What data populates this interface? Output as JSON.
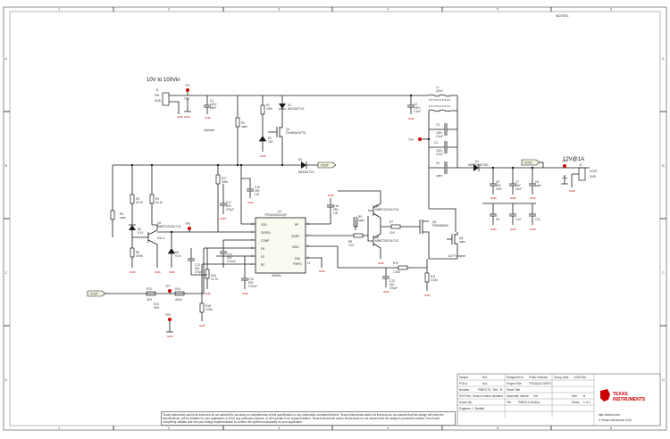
{
  "grid": {
    "cols": [
      "1",
      "2",
      "3",
      "4",
      "5",
      "6"
    ],
    "rows": [
      "A",
      "B",
      "C",
      "D"
    ]
  },
  "notes_label": "NOTES:",
  "input": {
    "range": "10V to 100Vin",
    "connector": "J1",
    "pin_vin": "VIN",
    "pin_gnd": "GND"
  },
  "output": {
    "rating": "12V@1A",
    "connector": "J2",
    "pin_vout": "VOUT",
    "pin_gnd": "GND"
  },
  "ic": {
    "ref": "U1",
    "part": "TPS40210DGQR",
    "freq": "300kHz",
    "pins_left": [
      "VDD",
      "DIS/EN",
      "COMP",
      "FB",
      "SS",
      "RC"
    ],
    "pins_right": [
      "BP",
      "GDRV",
      "ISNS",
      "PAD",
      "PWPD"
    ],
    "pin_nums_left": [
      "10",
      "2",
      "4",
      "5",
      "3",
      "1"
    ],
    "pin_nums_right": [
      "8",
      "7",
      "6",
      "9",
      "11"
    ]
  },
  "components": {
    "d1": "D1",
    "d1p": "BAS16HT1G",
    "q1": "Q1",
    "q1p": "ZXMN3A01FTA",
    "d2": "D2",
    "d2v": "15V",
    "r1": "R1",
    "r1v": "100k",
    "c1": "C1",
    "c1a": "100V",
    "c1b": "68uF",
    "c1c": "Optional",
    "r2": "R2",
    "r2v": "open",
    "d3": "D3",
    "d3p": "BAS16LT1G",
    "l1": "L1",
    "l1v": "47uH",
    "c2": "C2",
    "c2a": "100V",
    "c2b": "2.2uF",
    "c3": "C3",
    "c4": "C4",
    "c5": "C5",
    "c5v": "open",
    "c34a": "100V",
    "c34b": "2.2uF",
    "d4": "D4",
    "d4p": "MBRS3200T3G",
    "c6": "C6",
    "c7": "C7",
    "c8": "C8",
    "c8v": "open",
    "c67a": "16V",
    "c67b": "22uF",
    "c9": "C9",
    "c10": "C10",
    "c11": "C11",
    "c911v": "open",
    "r3": "R3",
    "r3v": "30.1k",
    "r4": "R4",
    "r4v": "30.1k",
    "r5": "R5",
    "r5v": "open",
    "d5": "D5",
    "d5v": "9.1V",
    "d6": "D6",
    "d6v": "9.1V",
    "r6": "R6",
    "r6v": "49.9k",
    "q2": "Q2",
    "q2p": "MMBT2222ALT1G",
    "uvlo": "UVLO",
    "r7": "R7",
    "r7v": "10.0",
    "r8": "R8",
    "r8v": "10.0",
    "r9": "R9",
    "r9v": "open",
    "q3": "Q3",
    "q3p": "MMBT2222ALT1G",
    "q5": "Q5",
    "q5p": "MMBT2907ALT1G",
    "q4": "Q4",
    "q4p": "FDMS86200",
    "q6": "Q6",
    "q6v": "open",
    "alt": "ALT Footprint",
    "c12": "C12",
    "c12a": "25V",
    "c12b": "1uF",
    "c13": "C13",
    "c13a": "50V",
    "c13b": "270pF",
    "c14": "C14",
    "c14a": "50V",
    "c14b": "0.01uF",
    "c15": "C15",
    "c15a": "50V",
    "c15b": "0.22uF",
    "c16": "C16",
    "c16a": "25V",
    "c16b": "1uF",
    "c17": "C17",
    "c17a": "50V",
    "c17b": "270pF",
    "c18": "C18",
    "c18a": "50V",
    "c18b": "270pF",
    "r10": "R10",
    "r10v": "1.00k",
    "r11": "R11",
    "r11v": "0.033",
    "r12": "R12",
    "r12v": "49.9",
    "r13": "R13",
    "r13v": "49.9",
    "r14": "R14",
    "r14v": "49.9k",
    "r15": "R15",
    "r15v": "3.09k",
    "r16": "R16",
    "r16v": "12.7k",
    "r17": "R17",
    "r17v": "300k",
    "r18": "R18",
    "r18v": "open",
    "tp1": "TP1",
    "tp2": "TP2",
    "tp3": "TP3",
    "tp4": "TP4",
    "tp5": "TP5",
    "tp6": "TP6",
    "tp7": "TP7",
    "tp8": "TP8"
  },
  "nets": {
    "vout": "VOUT",
    "gnd": "GND"
  },
  "title_block": {
    "r1": [
      [
        "Variant",
        "N/A"
      ],
      [
        "PCB #",
        "N/A"
      ],
      [
        "Number",
        "PWP/CTG"
      ],
      [
        "Rev",
        "B"
      ]
    ],
    "r2": [
      [
        "Designed For",
        "Public Release"
      ],
      [
        "Project Title",
        "TPS40210 SEPIC"
      ],
      [
        "Sheet Title",
        ""
      ],
      [
        "Assembly Variant",
        "001"
      ],
      [
        "File",
        "PWR112.SchDoc"
      ]
    ],
    "r3": [
      [
        "Group Date",
        "12/3/2015"
      ],
      [
        "Size",
        "B"
      ],
      [
        "Sheet",
        "1 of 1"
      ]
    ],
    "svn": "SVN Rev: Version control disabled",
    "drawn": "Drawn By:",
    "engineer": "Engineer: J. Bartlett",
    "url1": "http://www.ti.com",
    "url2": "© Texas Instruments 2015"
  },
  "logo": {
    "line1": "TEXAS",
    "line2": "INSTRUMENTS"
  },
  "disclaimer": "Texas Instruments and/or its licensors do not warrant the accuracy or completeness of this specification or any information contained therein. Texas Instruments and/or its licensors do not warrant that this design will meet the specifications, will be suitable for your application or fit for any particular purpose, or will operate in an implementation. Texas Instruments and/or its licensors do not warrant that the design is production worthy. You should completely validate and test your design implementation to confirm the system functionality for your application."
}
